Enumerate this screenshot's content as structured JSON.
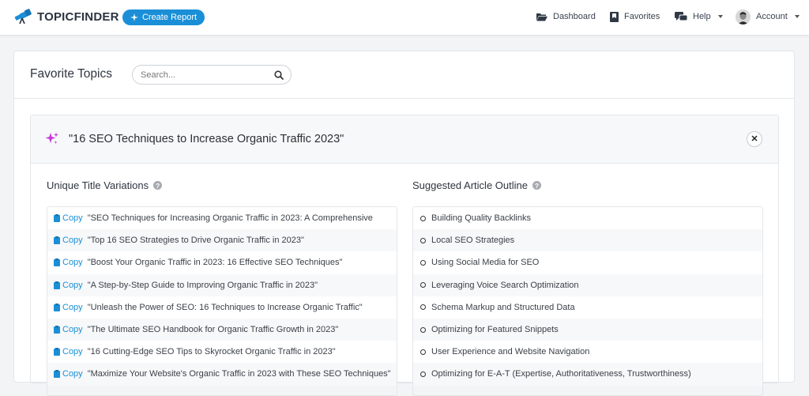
{
  "nav": {
    "logo_text": "TOPICFINDER",
    "create_label": "Create Report",
    "items": [
      {
        "label": "Dashboard",
        "icon": "folder-open-icon"
      },
      {
        "label": "Favorites",
        "icon": "bookmark-icon"
      },
      {
        "label": "Help",
        "icon": "chat-icon"
      },
      {
        "label": "Account",
        "icon": "avatar"
      }
    ]
  },
  "page": {
    "title": "Favorite Topics",
    "search_placeholder": "Search..."
  },
  "topic": {
    "title": "\"16 SEO Techniques to Increase Organic Traffic 2023\""
  },
  "titles_section": {
    "heading": "Unique Title Variations",
    "copy_label": "Copy",
    "items": [
      "\"SEO Techniques for Increasing Organic Traffic in 2023: A Comprehensive",
      "\"Top 16 SEO Strategies to Drive Organic Traffic in 2023\"",
      "\"Boost Your Organic Traffic in 2023: 16 Effective SEO Techniques\"",
      "\"A Step-by-Step Guide to Improving Organic Traffic in 2023\"",
      "\"Unleash the Power of SEO: 16 Techniques to Increase Organic Traffic\"",
      "\"The Ultimate SEO Handbook for Organic Traffic Growth in 2023\"",
      "\"16 Cutting-Edge SEO Tips to Skyrocket Organic Traffic in 2023\"",
      "\"Maximize Your Website's Organic Traffic in 2023 with These SEO Techniques\""
    ]
  },
  "outline_section": {
    "heading": "Suggested Article Outline",
    "items": [
      "Building Quality Backlinks",
      "Local SEO Strategies",
      "Using Social Media for SEO",
      "Leveraging Voice Search Optimization",
      "Schema Markup and Structured Data",
      "Optimizing for Featured Snippets",
      "User Experience and Website Navigation",
      "Optimizing for E-A-T (Expertise, Authoritativeness, Trustworthiness)"
    ]
  },
  "colors": {
    "accent": "#1a8fd7",
    "sparkle": "#c43bd8"
  }
}
